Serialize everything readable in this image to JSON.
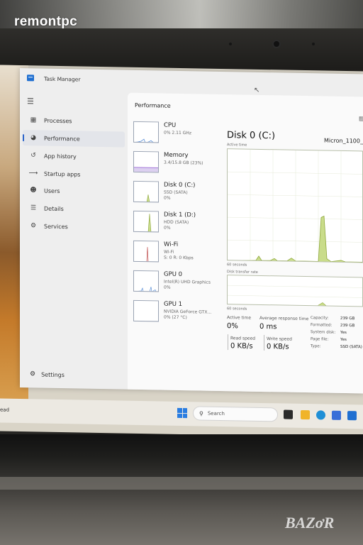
{
  "watermark": "remontpc",
  "window": {
    "title": "Task Manager"
  },
  "nav": {
    "items": [
      {
        "label": "Processes",
        "icon": "processes-icon"
      },
      {
        "label": "Performance",
        "icon": "performance-icon"
      },
      {
        "label": "App history",
        "icon": "app-history-icon"
      },
      {
        "label": "Startup apps",
        "icon": "startup-apps-icon"
      },
      {
        "label": "Users",
        "icon": "users-icon"
      },
      {
        "label": "Details",
        "icon": "details-icon"
      },
      {
        "label": "Services",
        "icon": "services-icon"
      }
    ],
    "active_index": 1,
    "settings_label": "Settings"
  },
  "performance": {
    "title": "Performance",
    "resources": [
      {
        "name": "CPU",
        "sub1": "0% 2.11 GHz",
        "sub2": ""
      },
      {
        "name": "Memory",
        "sub1": "3.4/15.8 GB (23%)",
        "sub2": ""
      },
      {
        "name": "Disk 0 (C:)",
        "sub1": "SSD (SATA)",
        "sub2": "0%"
      },
      {
        "name": "Disk 1 (D:)",
        "sub1": "HDD (SATA)",
        "sub2": "0%"
      },
      {
        "name": "Wi-Fi",
        "sub1": "Wi-Fi",
        "sub2": "S: 0 R: 0 Kbps"
      },
      {
        "name": "GPU 0",
        "sub1": "Intel(R) UHD Graphics",
        "sub2": "0%"
      },
      {
        "name": "GPU 1",
        "sub1": "NVIDIA GeForce GTX...",
        "sub2": "0% (27 °C)"
      }
    ],
    "detail": {
      "title": "Disk 0 (C:)",
      "model": "Micron_1100_",
      "active_time_graph_label": "Active time",
      "graph1_time_label": "60 seconds",
      "transfer_graph_label": "Disk transfer rate",
      "graph2_time_label": "60 seconds",
      "stats": {
        "active_time_label": "Active time",
        "active_time_value": "0%",
        "avg_response_label": "Average response time",
        "avg_response_value": "0 ms",
        "read_speed_label": "Read speed",
        "read_speed_value": "0 KB/s",
        "write_speed_label": "Write speed",
        "write_speed_value": "0 KB/s"
      },
      "properties": [
        {
          "key": "Capacity:",
          "value": "239 GB"
        },
        {
          "key": "Formatted:",
          "value": "239 GB"
        },
        {
          "key": "System disk:",
          "value": "Yes"
        },
        {
          "key": "Page file:",
          "value": "Yes"
        },
        {
          "key": "Type:",
          "value": "SSD (SATA)"
        }
      ]
    }
  },
  "taskbar": {
    "left_text": "ead",
    "search_placeholder": "Search"
  },
  "brand_logo": "BAZAR",
  "colors": {
    "accent": "#2962c9",
    "disk_graph_fill": "#c9dc8a",
    "disk_graph_line": "#8fa83c",
    "cpu_graph": "#5b8fd6",
    "memory_graph": "#9c6ad6",
    "wifi_graph": "#c05050"
  }
}
